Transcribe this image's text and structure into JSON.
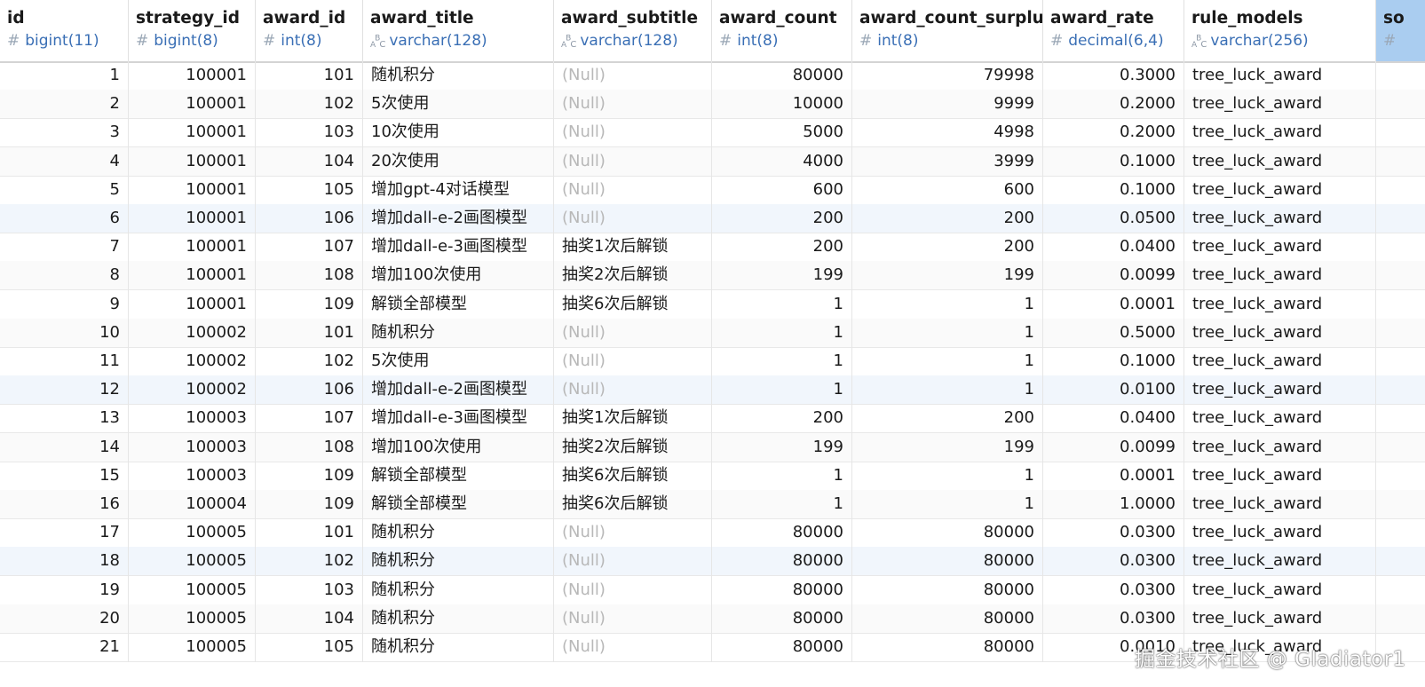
{
  "columns": [
    {
      "name": "id",
      "type": "bigint(11)",
      "icon": "hash-icon",
      "align": "right"
    },
    {
      "name": "strategy_id",
      "type": "bigint(8)",
      "icon": "hash-icon",
      "align": "right"
    },
    {
      "name": "award_id",
      "type": "int(8)",
      "icon": "hash-icon",
      "align": "right"
    },
    {
      "name": "award_title",
      "type": "varchar(128)",
      "icon": "abc-icon",
      "align": "left"
    },
    {
      "name": "award_subtitle",
      "type": "varchar(128)",
      "icon": "abc-icon",
      "align": "left"
    },
    {
      "name": "award_count",
      "type": "int(8)",
      "icon": "hash-icon",
      "align": "right"
    },
    {
      "name": "award_count_surplus",
      "type": "int(8)",
      "icon": "hash-icon",
      "align": "right"
    },
    {
      "name": "award_rate",
      "type": "decimal(6,4)",
      "icon": "hash-icon",
      "align": "right"
    },
    {
      "name": "rule_models",
      "type": "varchar(256)",
      "icon": "abc-icon",
      "align": "left"
    },
    {
      "name": "so",
      "type": "",
      "icon": "hash-icon",
      "align": "left"
    }
  ],
  "null_text": "(Null)",
  "rows": [
    [
      "1",
      "100001",
      "101",
      "随机积分",
      null,
      "80000",
      "79998",
      "0.3000",
      "tree_luck_award"
    ],
    [
      "2",
      "100001",
      "102",
      "5次使用",
      null,
      "10000",
      "9999",
      "0.2000",
      "tree_luck_award"
    ],
    [
      "3",
      "100001",
      "103",
      "10次使用",
      null,
      "5000",
      "4998",
      "0.2000",
      "tree_luck_award"
    ],
    [
      "4",
      "100001",
      "104",
      "20次使用",
      null,
      "4000",
      "3999",
      "0.1000",
      "tree_luck_award"
    ],
    [
      "5",
      "100001",
      "105",
      "增加gpt-4对话模型",
      null,
      "600",
      "600",
      "0.1000",
      "tree_luck_award"
    ],
    [
      "6",
      "100001",
      "106",
      "增加dall-e-2画图模型",
      null,
      "200",
      "200",
      "0.0500",
      "tree_luck_award"
    ],
    [
      "7",
      "100001",
      "107",
      "增加dall-e-3画图模型",
      "抽奖1次后解锁",
      "200",
      "200",
      "0.0400",
      "tree_luck_award"
    ],
    [
      "8",
      "100001",
      "108",
      "增加100次使用",
      "抽奖2次后解锁",
      "199",
      "199",
      "0.0099",
      "tree_luck_award"
    ],
    [
      "9",
      "100001",
      "109",
      "解锁全部模型",
      "抽奖6次后解锁",
      "1",
      "1",
      "0.0001",
      "tree_luck_award"
    ],
    [
      "10",
      "100002",
      "101",
      "随机积分",
      null,
      "1",
      "1",
      "0.5000",
      "tree_luck_award"
    ],
    [
      "11",
      "100002",
      "102",
      "5次使用",
      null,
      "1",
      "1",
      "0.1000",
      "tree_luck_award"
    ],
    [
      "12",
      "100002",
      "106",
      "增加dall-e-2画图模型",
      null,
      "1",
      "1",
      "0.0100",
      "tree_luck_award"
    ],
    [
      "13",
      "100003",
      "107",
      "增加dall-e-3画图模型",
      "抽奖1次后解锁",
      "200",
      "200",
      "0.0400",
      "tree_luck_award"
    ],
    [
      "14",
      "100003",
      "108",
      "增加100次使用",
      "抽奖2次后解锁",
      "199",
      "199",
      "0.0099",
      "tree_luck_award"
    ],
    [
      "15",
      "100003",
      "109",
      "解锁全部模型",
      "抽奖6次后解锁",
      "1",
      "1",
      "0.0001",
      "tree_luck_award"
    ],
    [
      "16",
      "100004",
      "109",
      "解锁全部模型",
      "抽奖6次后解锁",
      "1",
      "1",
      "1.0000",
      "tree_luck_award"
    ],
    [
      "17",
      "100005",
      "101",
      "随机积分",
      null,
      "80000",
      "80000",
      "0.0300",
      "tree_luck_award"
    ],
    [
      "18",
      "100005",
      "102",
      "随机积分",
      null,
      "80000",
      "80000",
      "0.0300",
      "tree_luck_award"
    ],
    [
      "19",
      "100005",
      "103",
      "随机积分",
      null,
      "80000",
      "80000",
      "0.0300",
      "tree_luck_award"
    ],
    [
      "20",
      "100005",
      "104",
      "随机积分",
      null,
      "80000",
      "80000",
      "0.0300",
      "tree_luck_award"
    ],
    [
      "21",
      "100005",
      "105",
      "随机积分",
      null,
      "80000",
      "80000",
      "0.0010",
      "tree_luck_award"
    ]
  ],
  "highlighted_rows": [
    6,
    12,
    18
  ],
  "watermark": "掘金技术社区 @ Gladiator1",
  "colors": {
    "type_text": "#3a6fb5",
    "null_text": "#b8b8b8",
    "selected_column": "#aacdf0"
  }
}
